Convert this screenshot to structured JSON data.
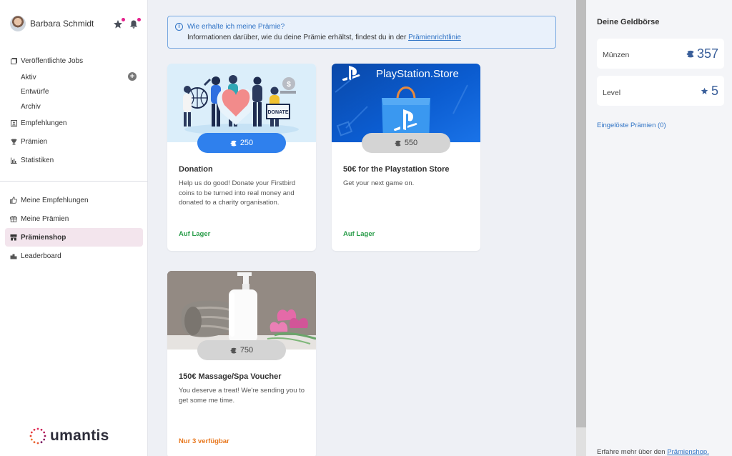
{
  "user": {
    "name": "Barbara Schmidt"
  },
  "top_icons": [
    "star-icon",
    "bell-icon"
  ],
  "nav": {
    "jobs": "Veröffentlichte Jobs",
    "jobs_sub": [
      "Aktiv",
      "Entwürfe",
      "Archiv"
    ],
    "empfehlungen": "Empfehlungen",
    "praemien": "Prämien",
    "statistiken": "Statistiken",
    "meine_empfehlungen": "Meine Empfehlungen",
    "meine_praemien": "Meine Prämien",
    "praemienshop": "Prämienshop",
    "leaderboard": "Leaderboard"
  },
  "logo": {
    "text": "umantis"
  },
  "info": {
    "title": "Wie erhalte ich meine Prämie?",
    "text": "Informationen darüber, wie du deine Prämie erhältst, findest du in der ",
    "link": "Prämienrichtlinie"
  },
  "cards": [
    {
      "price": "250",
      "title": "Donation",
      "description": "Help us do good! Donate your Firstbird coins to be turned into real money and donated to a charity organisation.",
      "stock": "Auf Lager",
      "image_label": "DONATE"
    },
    {
      "price": "550",
      "title": "50€ for the Playstation Store",
      "description": "Get your next game on.",
      "stock": "Auf Lager",
      "image_label": "PlayStation.Store"
    },
    {
      "price": "750",
      "title": "150€ Massage/Spa Voucher",
      "description": "You deserve a treat! We're sending you to get some me time.",
      "stock": "Nur 3 verfügbar"
    }
  ],
  "wallet": {
    "title": "Deine Geldbörse",
    "coins_label": "Münzen",
    "coins_value": "357",
    "level_label": "Level",
    "level_value": "5",
    "redeemed_link": "Eingelöste Prämien (0)",
    "footer_text": "Erfahre mehr über den ",
    "footer_link": "Prämienshop."
  },
  "colors": {
    "accent": "#2f80ed",
    "link": "#2f73c5",
    "active_bg": "#f3e5ed",
    "badge": "#e5208c",
    "green": "#2a9d4a",
    "orange": "#e8781f"
  }
}
